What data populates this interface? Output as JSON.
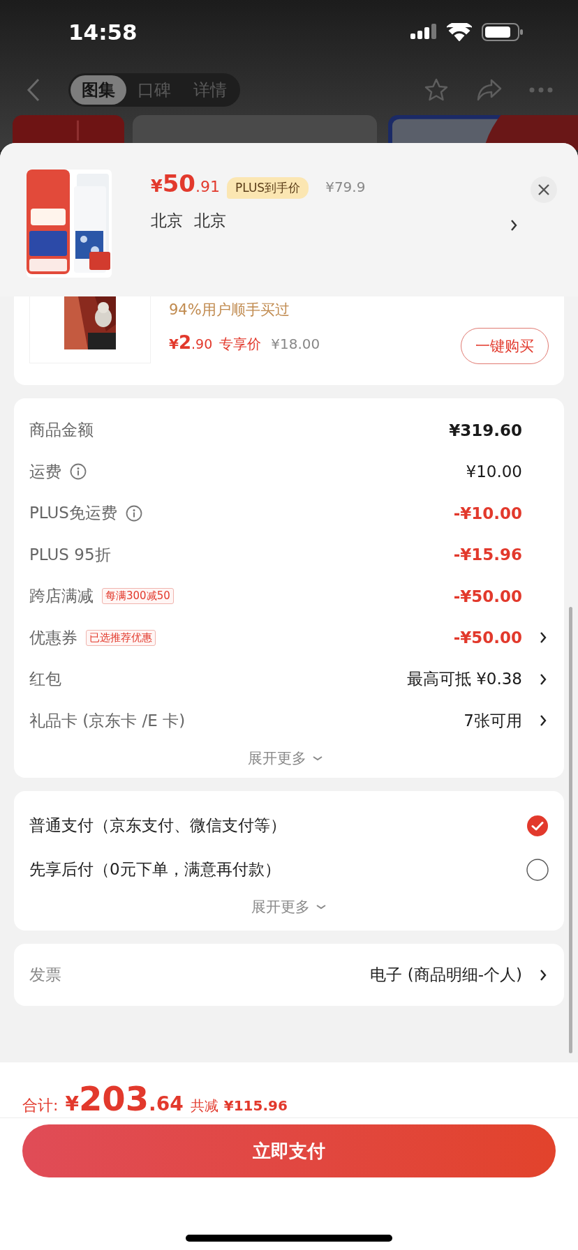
{
  "status_bar": {
    "time": "14:58"
  },
  "nav": {
    "tabs": [
      {
        "label": "图集",
        "selected": true
      },
      {
        "label": "口碑",
        "selected": false
      },
      {
        "label": "详情",
        "selected": false
      }
    ]
  },
  "product": {
    "price": {
      "currency": "¥",
      "integer": "50",
      "decimal": ".91"
    },
    "badge": "PLUS到手价",
    "original_price": "¥79.9",
    "address": [
      "北京",
      "北京"
    ]
  },
  "upsell": {
    "note": "94%用户顺手买过",
    "price": {
      "currency": "¥",
      "integer": "2",
      "decimal": ".90"
    },
    "price_label": "专享价",
    "original_price": "¥18.00",
    "button": "一键购买"
  },
  "fees": {
    "rows": [
      {
        "label": "商品金额",
        "info": false,
        "value": "¥319.60",
        "kind": "total",
        "arrow": false
      },
      {
        "label": "运费",
        "info": true,
        "value": "¥10.00",
        "kind": "charge",
        "arrow": false
      },
      {
        "label": "PLUS免运费",
        "info": true,
        "value": "-¥10.00",
        "kind": "discount",
        "arrow": false
      },
      {
        "label": "PLUS 95折",
        "info": false,
        "value": "-¥15.96",
        "kind": "discount",
        "arrow": false
      },
      {
        "label": "跨店满减",
        "info": false,
        "tag": "每满300减50",
        "value": "-¥50.00",
        "kind": "discount",
        "arrow": false
      },
      {
        "label": "优惠券",
        "info": false,
        "tag": "已选推荐优惠",
        "value": "-¥50.00",
        "kind": "discount",
        "arrow": true
      },
      {
        "label": "红包",
        "info": false,
        "value": "最高可抵 ¥0.38",
        "kind": "charge",
        "arrow": true
      },
      {
        "label": "礼品卡 (京东卡 /E 卡)",
        "info": false,
        "value": "7张可用",
        "kind": "charge",
        "arrow": true
      }
    ],
    "more": "展开更多"
  },
  "payment": {
    "options": [
      {
        "label": "普通支付（京东支付、微信支付等）",
        "selected": true
      },
      {
        "label": "先享后付（0元下单，满意再付款）",
        "selected": false
      }
    ],
    "more": "展开更多"
  },
  "invoice": {
    "label": "发票",
    "value": "电子 (商品明细-个人)"
  },
  "footer": {
    "total_label": "合计:",
    "total": {
      "currency": "¥",
      "integer": "203",
      "decimal": ".64"
    },
    "saved_label": "共减",
    "saved": "¥115.96",
    "button": "立即支付"
  }
}
